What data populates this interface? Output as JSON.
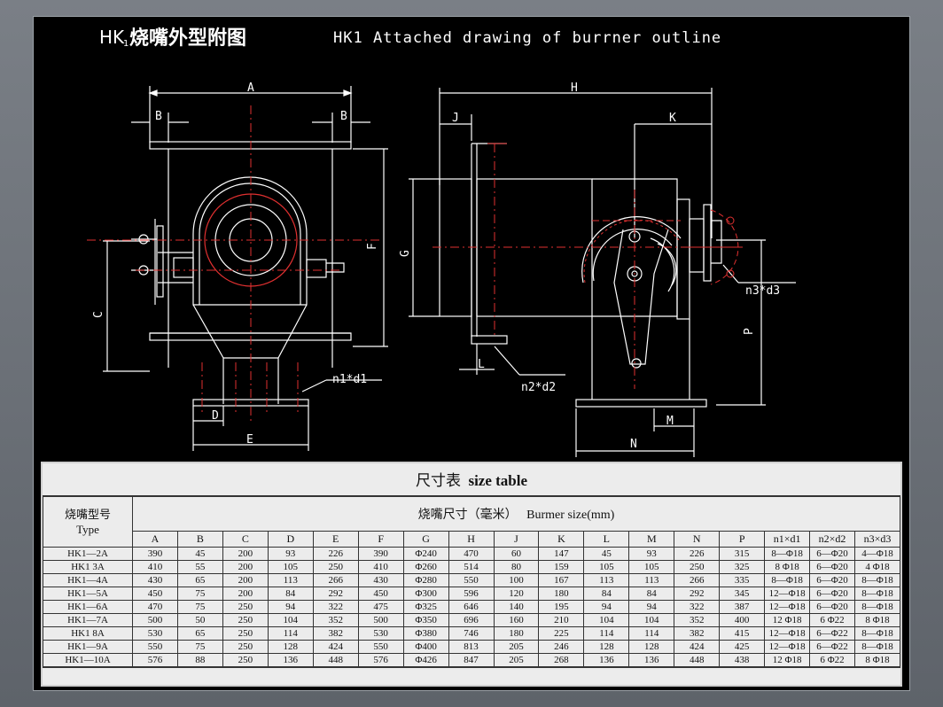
{
  "header": {
    "title_prefix": "HK",
    "title_sub": "1",
    "title_cn": "烧嘴外型附图",
    "title_en": "HK1 Attached drawing of burrner outline"
  },
  "dimension_labels": {
    "A": "A",
    "B_left": "B",
    "B_right": "B",
    "C": "C",
    "D": "D",
    "E": "E",
    "F": "F",
    "G": "G",
    "H": "H",
    "J": "J",
    "K": "K",
    "L": "L",
    "M": "M",
    "N": "N",
    "P": "P",
    "n1d1": "n1*d1",
    "n2d2": "n2*d2",
    "n3d3": "n3*d3"
  },
  "table": {
    "caption_cn": "尺寸表",
    "caption_en": "size table",
    "type_header_cn": "烧嘴型号",
    "type_header_en": "Type",
    "size_header_cn": "烧嘴尺寸（毫米）",
    "size_header_en": "Burmer size(mm)",
    "columns": [
      "A",
      "B",
      "C",
      "D",
      "E",
      "F",
      "G",
      "H",
      "J",
      "K",
      "L",
      "M",
      "N",
      "P",
      "n1×d1",
      "n2×d2",
      "n3×d3"
    ],
    "rows": [
      [
        "HK1—2A",
        "390",
        "45",
        "200",
        "93",
        "226",
        "390",
        "Φ240",
        "470",
        "60",
        "147",
        "45",
        "93",
        "226",
        "315",
        "8—Φ18",
        "6—Φ20",
        "4—Φ18"
      ],
      [
        "HK1 3A",
        "410",
        "55",
        "200",
        "105",
        "250",
        "410",
        "Φ260",
        "514",
        "80",
        "159",
        "105",
        "105",
        "250",
        "325",
        "8 Φ18",
        "6—Φ20",
        "4 Φ18"
      ],
      [
        "HK1—4A",
        "430",
        "65",
        "200",
        "113",
        "266",
        "430",
        "Φ280",
        "550",
        "100",
        "167",
        "113",
        "113",
        "266",
        "335",
        "8—Φ18",
        "6—Φ20",
        "8—Φ18"
      ],
      [
        "HK1—5A",
        "450",
        "75",
        "200",
        "84",
        "292",
        "450",
        "Φ300",
        "596",
        "120",
        "180",
        "84",
        "84",
        "292",
        "345",
        "12—Φ18",
        "6—Φ20",
        "8—Φ18"
      ],
      [
        "HK1—6A",
        "470",
        "75",
        "250",
        "94",
        "322",
        "475",
        "Φ325",
        "646",
        "140",
        "195",
        "94",
        "94",
        "322",
        "387",
        "12—Φ18",
        "6—Φ20",
        "8—Φ18"
      ],
      [
        "HK1—7A",
        "500",
        "50",
        "250",
        "104",
        "352",
        "500",
        "Φ350",
        "696",
        "160",
        "210",
        "104",
        "104",
        "352",
        "400",
        "12 Φ18",
        "6 Φ22",
        "8 Φ18"
      ],
      [
        "HK1 8A",
        "530",
        "65",
        "250",
        "114",
        "382",
        "530",
        "Φ380",
        "746",
        "180",
        "225",
        "114",
        "114",
        "382",
        "415",
        "12—Φ18",
        "6—Φ22",
        "8—Φ18"
      ],
      [
        "HK1—9A",
        "550",
        "75",
        "250",
        "128",
        "424",
        "550",
        "Φ400",
        "813",
        "205",
        "246",
        "128",
        "128",
        "424",
        "425",
        "12—Φ18",
        "6—Φ22",
        "8—Φ18"
      ],
      [
        "HK1—10A",
        "576",
        "88",
        "250",
        "136",
        "448",
        "576",
        "Φ426",
        "847",
        "205",
        "268",
        "136",
        "136",
        "448",
        "438",
        "12 Φ18",
        "6 Φ22",
        "8 Φ18"
      ]
    ]
  }
}
